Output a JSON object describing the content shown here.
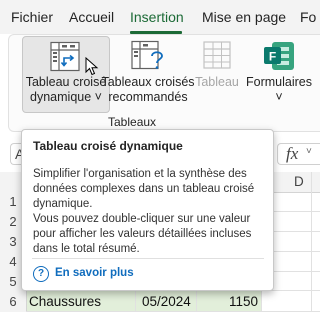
{
  "menu": {
    "tabs": [
      "Fichier",
      "Accueil",
      "Insertion",
      "Mise en page",
      "Fo"
    ],
    "active_tab": "Insertion"
  },
  "ribbon": {
    "pivot_table": {
      "line1": "Tableau croisé",
      "line2": "dynamique ˅"
    },
    "recommended_pivots": {
      "line1": "Tableaux croisés",
      "line2": "recommandés"
    },
    "table": {
      "label": "Tableau"
    },
    "forms": {
      "label": "Formulaires",
      "chevron": "˅"
    },
    "group_label": "Tableaux"
  },
  "formula_bar": {
    "namebox_value": "A",
    "fx_label": "fx",
    "chevron": "˅"
  },
  "grid": {
    "visible_column": "D",
    "row_numbers": [
      "1",
      "2",
      "3",
      "4",
      "5",
      "6"
    ],
    "row6": {
      "product": "Chaussures",
      "date": "05/2024",
      "value": "1150"
    }
  },
  "tooltip": {
    "title": "Tableau croisé dynamique",
    "paragraph1": "Simplifier l'organisation et la synthèse des données complexes dans un tableau croisé dynamique.",
    "paragraph2": "Vous pouvez double-cliquer sur une valeur pour afficher les valeurs détaillées incluses dans le total résumé.",
    "help_link": "En savoir plus"
  },
  "colors": {
    "accent_green": "#1c6a36",
    "link_blue": "#0f6cbd",
    "forms_icon": "#0b7a6d",
    "row_highlight": "#e2efda"
  }
}
